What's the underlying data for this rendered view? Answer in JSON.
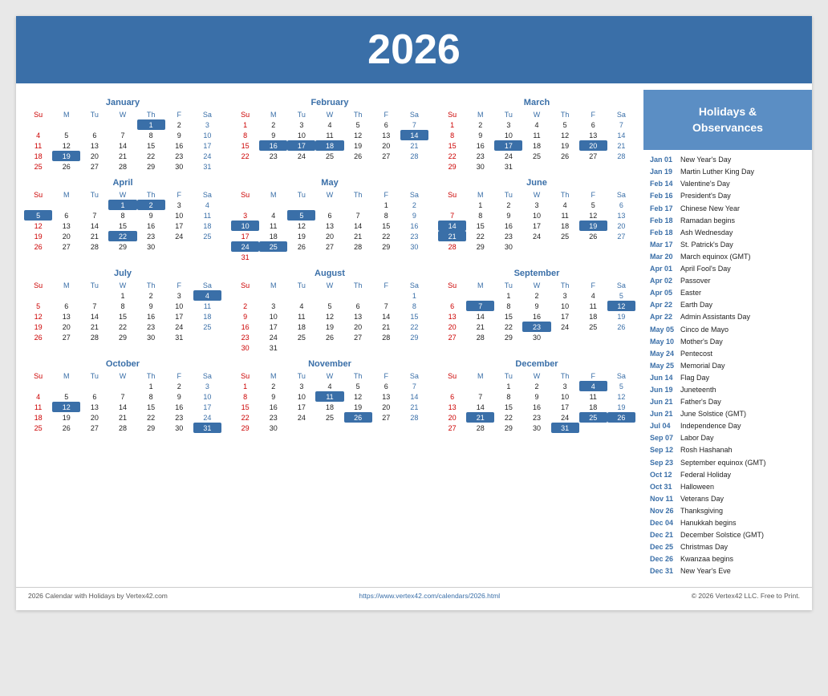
{
  "year": "2026",
  "sidebar": {
    "header": "Holidays &\nObservances",
    "holidays": [
      {
        "date": "Jan 01",
        "name": "New Year's Day"
      },
      {
        "date": "Jan 19",
        "name": "Martin Luther King Day"
      },
      {
        "date": "Feb 14",
        "name": "Valentine's Day"
      },
      {
        "date": "Feb 16",
        "name": "President's Day"
      },
      {
        "date": "Feb 17",
        "name": "Chinese New Year"
      },
      {
        "date": "Feb 18",
        "name": "Ramadan begins"
      },
      {
        "date": "Feb 18",
        "name": "Ash Wednesday"
      },
      {
        "date": "Mar 17",
        "name": "St. Patrick's Day"
      },
      {
        "date": "Mar 20",
        "name": "March equinox (GMT)"
      },
      {
        "date": "Apr 01",
        "name": "April Fool's Day"
      },
      {
        "date": "Apr 02",
        "name": "Passover"
      },
      {
        "date": "Apr 05",
        "name": "Easter"
      },
      {
        "date": "Apr 22",
        "name": "Earth Day"
      },
      {
        "date": "Apr 22",
        "name": "Admin Assistants Day"
      },
      {
        "date": "May 05",
        "name": "Cinco de Mayo"
      },
      {
        "date": "May 10",
        "name": "Mother's Day"
      },
      {
        "date": "May 24",
        "name": "Pentecost"
      },
      {
        "date": "May 25",
        "name": "Memorial Day"
      },
      {
        "date": "Jun 14",
        "name": "Flag Day"
      },
      {
        "date": "Jun 19",
        "name": "Juneteenth"
      },
      {
        "date": "Jun 21",
        "name": "Father's Day"
      },
      {
        "date": "Jun 21",
        "name": "June Solstice (GMT)"
      },
      {
        "date": "Jul 04",
        "name": "Independence Day"
      },
      {
        "date": "Sep 07",
        "name": "Labor Day"
      },
      {
        "date": "Sep 12",
        "name": "Rosh Hashanah"
      },
      {
        "date": "Sep 23",
        "name": "September equinox (GMT)"
      },
      {
        "date": "Oct 12",
        "name": "Federal Holiday"
      },
      {
        "date": "Oct 31",
        "name": "Halloween"
      },
      {
        "date": "Nov 11",
        "name": "Veterans Day"
      },
      {
        "date": "Nov 26",
        "name": "Thanksgiving"
      },
      {
        "date": "Dec 04",
        "name": "Hanukkah begins"
      },
      {
        "date": "Dec 21",
        "name": "December Solstice (GMT)"
      },
      {
        "date": "Dec 25",
        "name": "Christmas Day"
      },
      {
        "date": "Dec 26",
        "name": "Kwanzaa begins"
      },
      {
        "date": "Dec 31",
        "name": "New Year's Eve"
      }
    ]
  },
  "footer": {
    "left": "2026 Calendar with Holidays by Vertex42.com",
    "center": "https://www.vertex42.com/calendars/2026.html",
    "right": "© 2026 Vertex42 LLC. Free to Print."
  },
  "months": [
    {
      "name": "January",
      "weeks": [
        [
          null,
          null,
          null,
          null,
          "1h",
          "2",
          "3"
        ],
        [
          "4",
          "5",
          "6",
          "7",
          "8",
          "9",
          "10"
        ],
        [
          "11",
          "12",
          "13",
          "14",
          "15",
          "16",
          "17"
        ],
        [
          "18",
          "19h",
          "20",
          "21",
          "22",
          "23",
          "24"
        ],
        [
          "25",
          "26",
          "27",
          "28",
          "29",
          "30",
          "31"
        ]
      ]
    },
    {
      "name": "February",
      "weeks": [
        [
          "1",
          "2",
          "3",
          "4",
          "5",
          "6",
          "7"
        ],
        [
          "8",
          "9",
          "10",
          "11",
          "12",
          "13",
          "14h"
        ],
        [
          "15",
          "16h",
          "17h",
          "18h",
          "19",
          "20",
          "21"
        ],
        [
          "22",
          "23",
          "24",
          "25",
          "26",
          "27",
          "28"
        ]
      ]
    },
    {
      "name": "March",
      "weeks": [
        [
          "1",
          "2",
          "3",
          "4",
          "5",
          "6",
          "7"
        ],
        [
          "8",
          "9",
          "10",
          "11",
          "12",
          "13",
          "14"
        ],
        [
          "15",
          "16",
          "17h",
          "18",
          "19",
          "20h",
          "21"
        ],
        [
          "22",
          "23",
          "24",
          "25",
          "26",
          "27",
          "28"
        ],
        [
          "29",
          "30",
          "31",
          null,
          null,
          null,
          null
        ]
      ]
    },
    {
      "name": "April",
      "weeks": [
        [
          null,
          null,
          null,
          "1h",
          "2h",
          "3",
          "4"
        ],
        [
          "5h",
          "6",
          "7",
          "8",
          "9",
          "10",
          "11"
        ],
        [
          "12",
          "13",
          "14",
          "15",
          "16",
          "17",
          "18"
        ],
        [
          "19",
          "20",
          "21",
          "22h",
          "23",
          "24",
          "25"
        ],
        [
          "26",
          "27",
          "28",
          "29",
          "30",
          null,
          null
        ]
      ]
    },
    {
      "name": "May",
      "weeks": [
        [
          null,
          null,
          null,
          null,
          null,
          "1",
          "2"
        ],
        [
          "3",
          "4",
          "5h",
          "6",
          "7",
          "8",
          "9"
        ],
        [
          "10h",
          "11",
          "12",
          "13",
          "14",
          "15",
          "16"
        ],
        [
          "17",
          "18",
          "19",
          "20",
          "21",
          "22",
          "23"
        ],
        [
          "24h",
          "25h",
          "26",
          "27",
          "28",
          "29",
          "30"
        ],
        [
          "31",
          null,
          null,
          null,
          null,
          null,
          null
        ]
      ]
    },
    {
      "name": "June",
      "weeks": [
        [
          null,
          "1",
          "2",
          "3",
          "4",
          "5",
          "6"
        ],
        [
          "7",
          "8",
          "9",
          "10",
          "11",
          "12",
          "13"
        ],
        [
          "14h",
          "15",
          "16",
          "17",
          "18",
          "19h",
          "20"
        ],
        [
          "21h",
          "22",
          "23",
          "24",
          "25",
          "26",
          "27"
        ],
        [
          "28",
          "29",
          "30",
          null,
          null,
          null,
          null
        ]
      ]
    },
    {
      "name": "July",
      "weeks": [
        [
          null,
          null,
          null,
          "1",
          "2",
          "3",
          "4h"
        ],
        [
          "5",
          "6",
          "7",
          "8",
          "9",
          "10",
          "11"
        ],
        [
          "12",
          "13",
          "14",
          "15",
          "16",
          "17",
          "18"
        ],
        [
          "19",
          "20",
          "21",
          "22",
          "23",
          "24",
          "25"
        ],
        [
          "26",
          "27",
          "28",
          "29",
          "30",
          "31",
          null
        ]
      ]
    },
    {
      "name": "August",
      "weeks": [
        [
          null,
          null,
          null,
          null,
          null,
          null,
          "1"
        ],
        [
          "2",
          "3",
          "4",
          "5",
          "6",
          "7",
          "8"
        ],
        [
          "9",
          "10",
          "11",
          "12",
          "13",
          "14",
          "15"
        ],
        [
          "16",
          "17",
          "18",
          "19",
          "20",
          "21",
          "22"
        ],
        [
          "23",
          "24",
          "25",
          "26",
          "27",
          "28",
          "29"
        ],
        [
          "30",
          "31",
          null,
          null,
          null,
          null,
          null
        ]
      ]
    },
    {
      "name": "September",
      "weeks": [
        [
          null,
          null,
          "1",
          "2",
          "3",
          "4",
          "5"
        ],
        [
          "6",
          "7h",
          "8",
          "9",
          "10",
          "11",
          "12h"
        ],
        [
          "13",
          "14",
          "15",
          "16",
          "17",
          "18",
          "19"
        ],
        [
          "20",
          "21",
          "22",
          "23h",
          "24",
          "25",
          "26"
        ],
        [
          "27",
          "28",
          "29",
          "30",
          null,
          null,
          null
        ]
      ]
    },
    {
      "name": "October",
      "weeks": [
        [
          null,
          null,
          null,
          null,
          "1",
          "2",
          "3"
        ],
        [
          "4",
          "5",
          "6",
          "7",
          "8",
          "9",
          "10"
        ],
        [
          "11",
          "12h",
          "13",
          "14",
          "15",
          "16",
          "17"
        ],
        [
          "18",
          "19",
          "20",
          "21",
          "22",
          "23",
          "24"
        ],
        [
          "25",
          "26",
          "27",
          "28",
          "29",
          "30",
          "31h"
        ]
      ]
    },
    {
      "name": "November",
      "weeks": [
        [
          "1",
          "2",
          "3",
          "4",
          "5",
          "6",
          "7"
        ],
        [
          "8",
          "9",
          "10",
          "11h",
          "12",
          "13",
          "14"
        ],
        [
          "15",
          "16",
          "17",
          "18",
          "19",
          "20",
          "21"
        ],
        [
          "22",
          "23",
          "24",
          "25",
          "26h",
          "27",
          "28"
        ],
        [
          "29",
          "30",
          null,
          null,
          null,
          null,
          null
        ]
      ]
    },
    {
      "name": "December",
      "weeks": [
        [
          null,
          null,
          "1",
          "2",
          "3",
          "4h",
          "5"
        ],
        [
          "6",
          "7",
          "8",
          "9",
          "10",
          "11",
          "12"
        ],
        [
          "13",
          "14",
          "15",
          "16",
          "17",
          "18",
          "19"
        ],
        [
          "20",
          "21h",
          "22",
          "23",
          "24",
          "25h",
          "26h"
        ],
        [
          "27",
          "28",
          "29",
          "30",
          "31h",
          null,
          null
        ]
      ]
    }
  ]
}
